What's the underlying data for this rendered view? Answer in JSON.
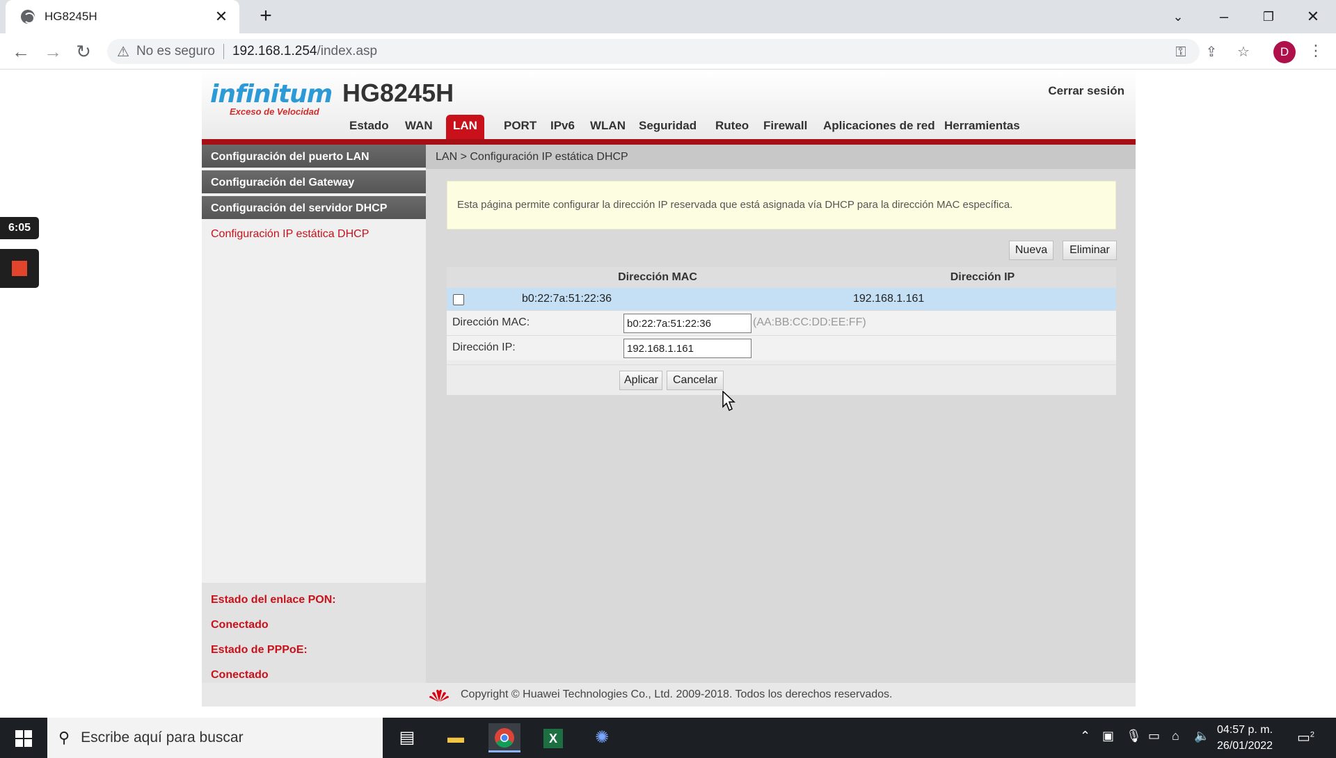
{
  "browser": {
    "tab_title": "HG8245H",
    "tab_close": "✕",
    "new_tab": "+",
    "not_secure": "No es seguro",
    "url_host": "192.168.1.254",
    "url_path": "/index.asp",
    "profile_initial": "D"
  },
  "recorder": {
    "time": "6:05"
  },
  "router": {
    "brand": "infinitum",
    "brand_tag": "Exceso de Velocidad",
    "model": "HG8245H",
    "logout": "Cerrar sesión",
    "nav": [
      "Estado",
      "WAN",
      "LAN",
      "PORT",
      "IPv6",
      "WLAN",
      "Seguridad",
      "Ruteo",
      "Firewall",
      "Aplicaciones de red",
      "Herramientas"
    ],
    "active_nav": "LAN",
    "sidebar": [
      "Configuración del puerto LAN",
      "Configuración del Gateway",
      "Configuración del servidor DHCP",
      "Configuración IP estática DHCP"
    ],
    "status": {
      "pon_label": "Estado del enlace PON:",
      "pon_value": "Conectado",
      "pppoe_label": "Estado de PPPoE:",
      "pppoe_value": "Conectado"
    },
    "breadcrumb": "LAN > Configuración IP estática DHCP",
    "info": "Esta página permite configurar la dirección IP reservada que está asignada vía DHCP para la dirección MAC específica.",
    "buttons": {
      "new": "Nueva",
      "delete": "Eliminar",
      "apply": "Aplicar",
      "cancel": "Cancelar"
    },
    "table": {
      "headers": [
        "Dirección MAC",
        "Dirección IP"
      ],
      "rows": [
        {
          "mac": "b0:22:7a:51:22:36",
          "ip": "192.168.1.161",
          "checked": false
        }
      ]
    },
    "form": {
      "mac_label": "Dirección MAC:",
      "mac_value": "b0:22:7a:51:22:36",
      "mac_hint": "(AA:BB:CC:DD:EE:FF)",
      "ip_label": "Dirección IP:",
      "ip_value": "192.168.1.161"
    },
    "footer": "Copyright © Huawei Technologies Co., Ltd. 2009-2018. Todos los derechos reservados."
  },
  "taskbar": {
    "search_placeholder": "Escribe aquí para buscar",
    "time": "04:57 p. m.",
    "date": "26/01/2022",
    "notifications": "2"
  },
  "colors": {
    "accent_red": "#c8111a",
    "brand_blue": "#2d9ad8",
    "selected_row": "#c5e0f5"
  }
}
